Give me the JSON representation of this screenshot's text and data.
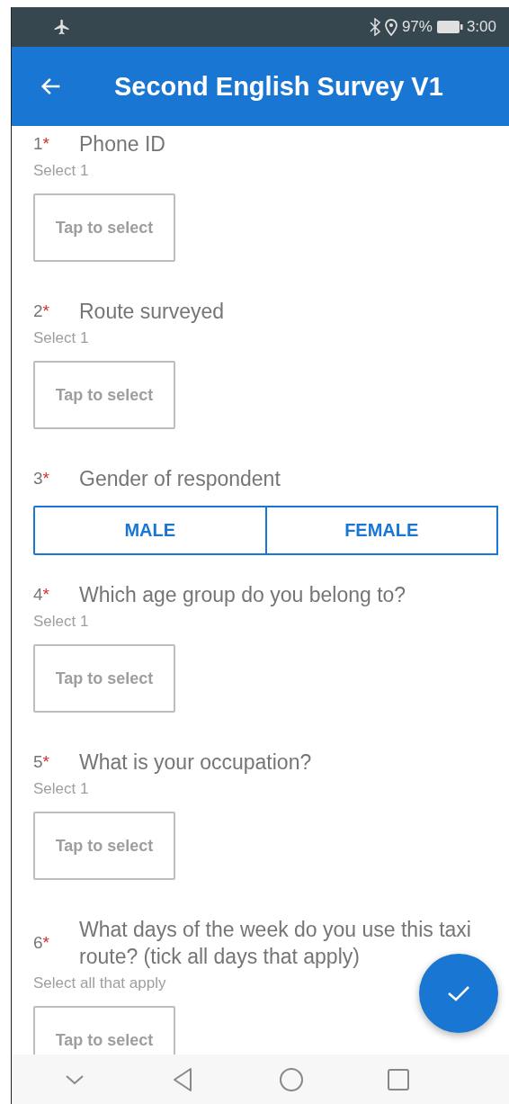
{
  "status_bar": {
    "battery": "97%",
    "time": "3:00"
  },
  "app_bar": {
    "title": "Second English Survey V1"
  },
  "questions": [
    {
      "kind": "select",
      "number": "1",
      "mark": "*",
      "title": "Phone ID",
      "hint": "Select 1",
      "placeholder": "Tap to select"
    },
    {
      "kind": "select",
      "number": "2",
      "mark": "*",
      "title": "Route surveyed",
      "hint": "Select 1",
      "placeholder": "Tap to select"
    },
    {
      "kind": "segmented",
      "number": "3",
      "mark": "*",
      "title": "Gender of respondent",
      "options": [
        {
          "label": "MALE",
          "selected": false
        },
        {
          "label": "FEMALE",
          "selected": false
        }
      ]
    },
    {
      "kind": "select",
      "number": "4",
      "mark": "*",
      "title": "Which age group do you belong to?",
      "hint": "Select 1",
      "placeholder": "Tap to select"
    },
    {
      "kind": "select",
      "number": "5",
      "mark": "*",
      "title": "What is your occupation?",
      "hint": "Select 1",
      "placeholder": "Tap to select"
    },
    {
      "kind": "select",
      "number": "6",
      "mark": "*",
      "title": "What days of the week do you use this taxi route? (tick all days that apply)",
      "hint": "Select all that apply",
      "placeholder": "Tap to select"
    }
  ]
}
